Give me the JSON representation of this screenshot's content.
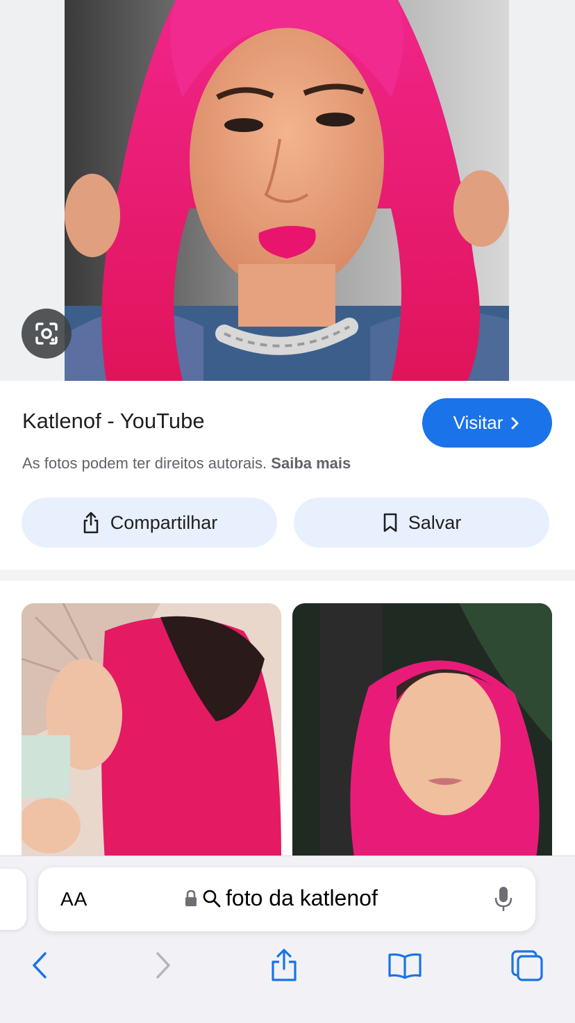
{
  "result": {
    "title": "Katlenof - YouTube",
    "visit_label": "Visitar",
    "copyright_text": "As fotos podem ter direitos autorais.",
    "learn_more": "Saiba mais",
    "share_label": "Compartilhar",
    "save_label": "Salvar"
  },
  "browser": {
    "text_size_label": "AA",
    "search_query": "foto da katlenof"
  },
  "colors": {
    "accent": "#1a73e8",
    "chip_bg": "#e8f0fe",
    "hair_pink": "#e8186e"
  },
  "icons": [
    "google-lens-icon",
    "chevron-right-icon",
    "share-icon",
    "bookmark-icon",
    "lock-icon",
    "search-icon",
    "microphone-icon",
    "back-icon",
    "forward-icon",
    "safari-share-icon",
    "bookmarks-icon",
    "tabs-icon"
  ]
}
